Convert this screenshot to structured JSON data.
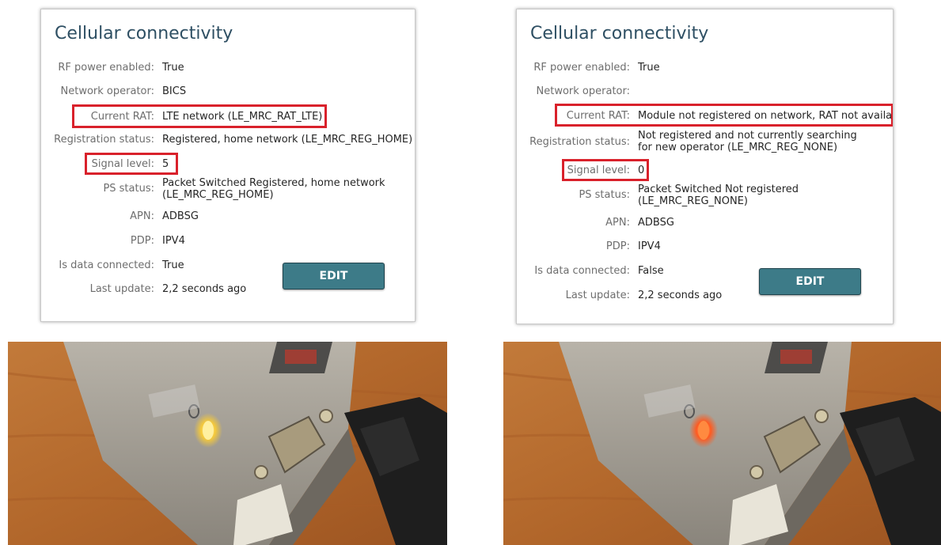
{
  "left_panel": {
    "title": "Cellular connectivity",
    "rows": [
      {
        "label": "RF power enabled:",
        "value": "True"
      },
      {
        "label": "Network operator:",
        "value": "BICS"
      },
      {
        "label": "Current RAT:",
        "value": "LTE network (LE_MRC_RAT_LTE)"
      },
      {
        "label": "Registration status:",
        "value": "Registered, home network (LE_MRC_REG_HOME)"
      },
      {
        "label": "Signal level:",
        "value": "5"
      },
      {
        "label": "PS status:",
        "value": "Packet Switched Registered, home network (LE_MRC_REG_HOME)"
      },
      {
        "label": "APN:",
        "value": "ADBSG"
      },
      {
        "label": "PDP:",
        "value": "IPV4"
      },
      {
        "label": "Is data connected:",
        "value": "True"
      },
      {
        "label": "Last update:",
        "value": "2,2 seconds ago"
      }
    ],
    "edit_label": "EDIT"
  },
  "right_panel": {
    "title": "Cellular connectivity",
    "rows": [
      {
        "label": "RF power enabled:",
        "value": "True"
      },
      {
        "label": "Network operator:",
        "value": ""
      },
      {
        "label": "Current RAT:",
        "value": "Module not registered on network, RAT not available"
      },
      {
        "label": "Registration status:",
        "value": "Not registered and not currently searching for new operator (LE_MRC_REG_NONE)"
      },
      {
        "label": "Signal level:",
        "value": "0"
      },
      {
        "label": "PS status:",
        "value": "Packet Switched Not registered (LE_MRC_REG_NONE)"
      },
      {
        "label": "APN:",
        "value": "ADBSG"
      },
      {
        "label": "PDP:",
        "value": "IPV4"
      },
      {
        "label": "Is data connected:",
        "value": "False"
      },
      {
        "label": "Last update:",
        "value": "2,2 seconds ago"
      }
    ],
    "edit_label": "EDIT"
  },
  "colors": {
    "highlight": "#d9212b",
    "title": "#2e4f63",
    "button": "#3d7b88",
    "led_left": "#f5c93a",
    "led_right": "#ff5a1f"
  }
}
